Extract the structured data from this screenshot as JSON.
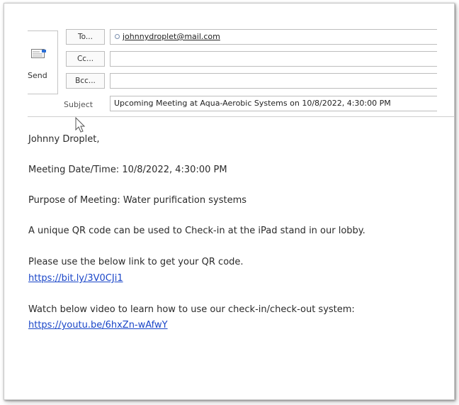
{
  "compose": {
    "send_label": "Send",
    "to_label": "To...",
    "cc_label": "Cc...",
    "bcc_label": "Bcc...",
    "to_value": "johnnydroplet@mail.com",
    "cc_value": "",
    "bcc_value": "",
    "subject_label": "Subject",
    "subject_value": "Upcoming Meeting at Aqua-Aerobic Systems on 10/8/2022, 4:30:00 PM"
  },
  "message": {
    "greeting": "Johnny Droplet,",
    "meeting_datetime": "Meeting Date/Time: 10/8/2022,  4:30:00 PM",
    "purpose": "Purpose of Meeting: Water purification systems",
    "qr_info": "A unique QR code can be used to Check-in at the iPad stand in our lobby.",
    "qr_link_intro": "Please use the below link to get your QR code.",
    "qr_link": "https://bit.ly/3V0CJi1",
    "video_intro": "Watch below video to learn how to use our check-in/check-out system:",
    "video_link": "https://youtu.be/6hxZn-wAfwY"
  },
  "icons": {
    "send": "send-envelope-icon",
    "cursor": "mouse-pointer-icon",
    "presence": "presence-status-icon"
  },
  "colors": {
    "link": "#1a46c8",
    "border": "#bdbdbd"
  }
}
